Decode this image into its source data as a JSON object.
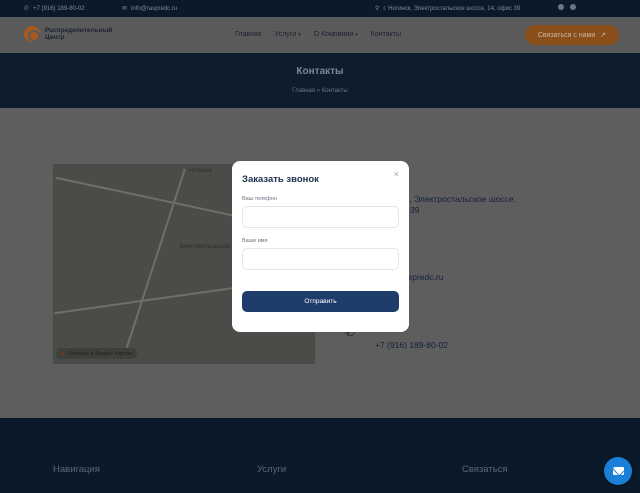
{
  "topbar": {
    "phone": "+7 (916) 189-80-02",
    "email": "info@raspredc.ru",
    "address": "г. Ногинск, Электростальское шоссе, 14, офис 39",
    "icons": [
      "phone-icon",
      "mail-icon",
      "location-pin-icon",
      "whatsapp-icon",
      "telegram-icon"
    ]
  },
  "header": {
    "logo_line1": "Распределительный",
    "logo_line2": "Центр",
    "nav": [
      {
        "label": "Главная"
      },
      {
        "label": "Услуги"
      },
      {
        "label": "О Компании"
      },
      {
        "label": "Контакты"
      }
    ],
    "cta_label": "Связаться с нами",
    "cta_icon": "arrow-up-right-icon"
  },
  "hero": {
    "title": "Контакты",
    "breadcrumbs": "Главная » Контакты"
  },
  "map": {
    "city_label": "Ногинск",
    "marker_label": "Электростальское ш.",
    "open_link": "Открыть в Яндекс Картах"
  },
  "contacts": {
    "address_line1": "Ногинск, Электростальское шоссе,",
    "address_line2": "39",
    "email_fragment": "spredc.ru",
    "phone": "+7 (916) 189-80-02"
  },
  "modal": {
    "title": "Заказать звонок",
    "close": "×",
    "phone_label": "Ваш телефон",
    "phone_value": "",
    "name_label": "Ваше имя",
    "name_value": "",
    "submit_label": "Отправить"
  },
  "footer": {
    "col1": "Навигация",
    "col2": "Услуги",
    "col3": "Связаться"
  },
  "colors": {
    "accent": "#e07b2a",
    "primary": "#1f3d6a",
    "fab": "#1a7fd6"
  }
}
